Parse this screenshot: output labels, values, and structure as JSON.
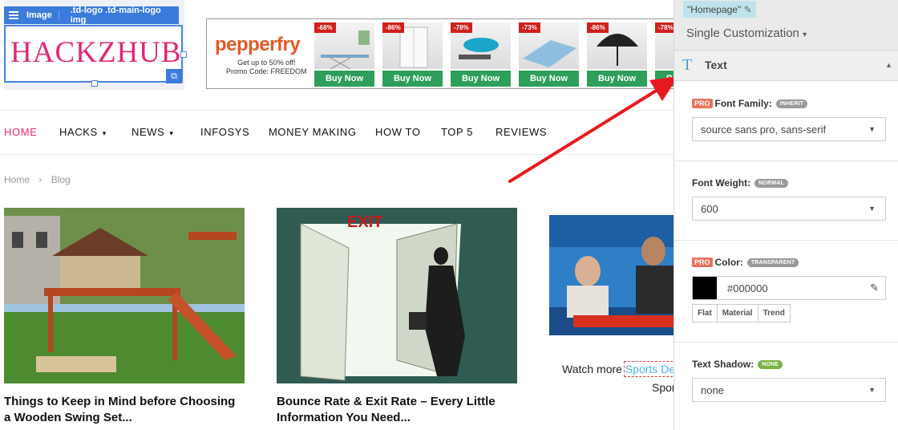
{
  "logo": {
    "toolbar_label": "Image",
    "selector": ".td-logo .td-main-logo img",
    "text": "HACKZHUB"
  },
  "banner": {
    "brand": "pepperfry",
    "tagline_line1": "Get up to 50% off!",
    "tagline_line2": "Promo Code: FREEDOM",
    "products": [
      {
        "discount": "-68%",
        "cta": "Buy Now"
      },
      {
        "discount": "-86%",
        "cta": "Buy Now"
      },
      {
        "discount": "-78%",
        "cta": "Buy Now"
      },
      {
        "discount": "-73%",
        "cta": "Buy Now"
      },
      {
        "discount": "-86%",
        "cta": "Buy Now"
      },
      {
        "discount": "-78%",
        "cta": "Buy Now"
      }
    ]
  },
  "nav": {
    "items": [
      {
        "label": "HOME",
        "active": true,
        "dropdown": false
      },
      {
        "label": "HACKS",
        "active": false,
        "dropdown": true
      },
      {
        "label": "NEWS",
        "active": false,
        "dropdown": true
      },
      {
        "label": "INFOSYS",
        "active": false,
        "dropdown": false
      },
      {
        "label": "MONEY MAKING",
        "active": false,
        "dropdown": false
      },
      {
        "label": "HOW TO",
        "active": false,
        "dropdown": false
      },
      {
        "label": "TOP 5",
        "active": false,
        "dropdown": false
      },
      {
        "label": "REVIEWS",
        "active": false,
        "dropdown": false
      }
    ]
  },
  "breadcrumb": {
    "home": "Home",
    "sep": "›",
    "current": "Blog"
  },
  "posts": [
    {
      "title": "Things to Keep in Mind before Choosing a Wooden Swing Set..."
    },
    {
      "title": "Bounce Rate & Exit Rate – Every Little Information You Need..."
    }
  ],
  "exit_sign": "EXIT",
  "third_post": {
    "prefix": "Watch more ",
    "link": "Sports De",
    "line2": "Spor"
  },
  "panel": {
    "page_tag": "\"Homepage\"",
    "customization": "Single Customization",
    "section_title": "Text",
    "font_family": {
      "pro": "PRO",
      "label": "Font Family:",
      "badge": "INHERIT",
      "value": "source sans pro, sans-serif"
    },
    "font_weight": {
      "label": "Font Weight:",
      "badge": "NORMAL",
      "value": "600"
    },
    "color": {
      "pro": "PRO",
      "label": "Color:",
      "badge": "TRANSPARENT",
      "value": "#000000",
      "modes": [
        "Flat",
        "Material",
        "Trend"
      ]
    },
    "text_shadow": {
      "label": "Text Shadow:",
      "badge": "NONE",
      "value": "none"
    }
  },
  "colors": {
    "accent_pink": "#e2287a",
    "editor_blue": "#3b7bd9",
    "arrow_red": "#e8191e",
    "link_blue": "#4db2ec"
  }
}
